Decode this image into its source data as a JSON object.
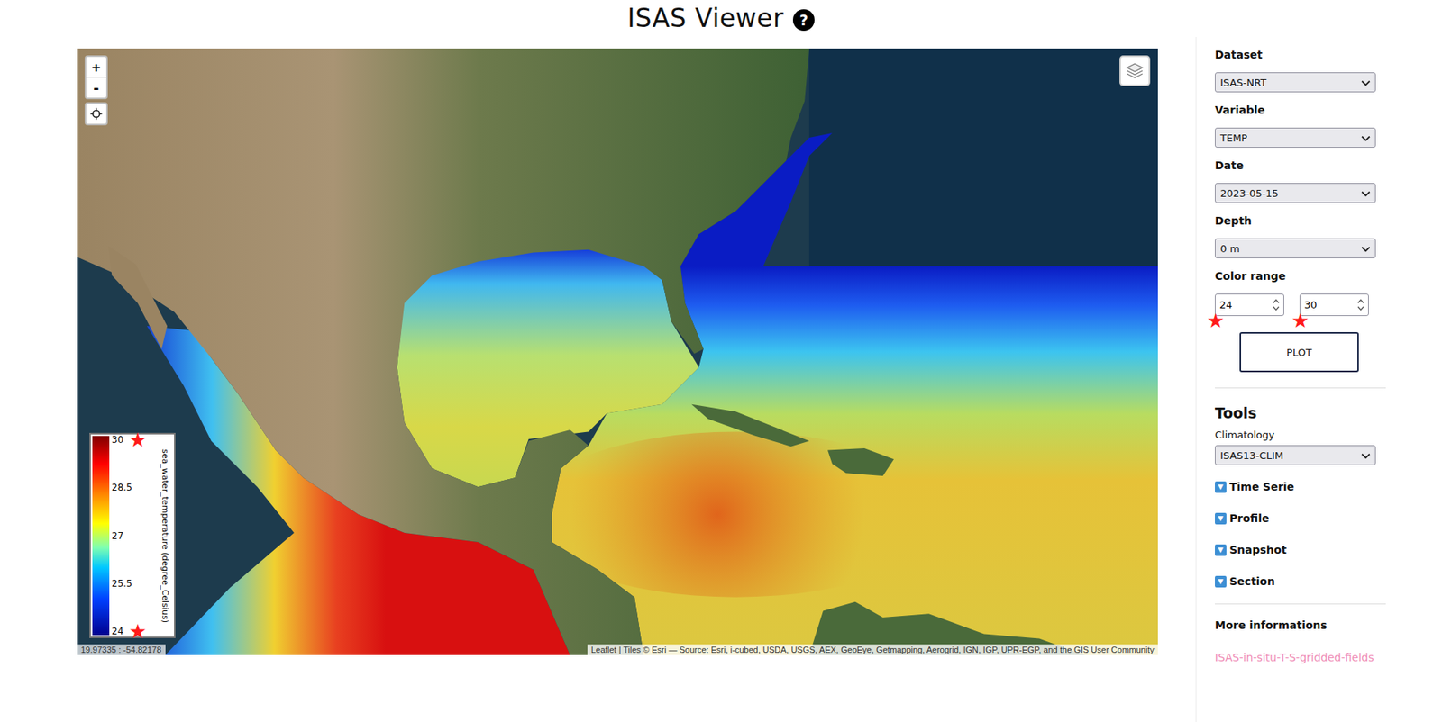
{
  "header": {
    "title": "ISAS Viewer",
    "help_icon": "?"
  },
  "map": {
    "zoom_in": "+",
    "zoom_out": "-",
    "coordinates": "19.97335 : -54.82178",
    "attribution": "Leaflet | Tiles © Esri — Source: Esri, i-cubed, USDA, USGS, AEX, GeoEye, Getmapping, Aerogrid, IGN, IGP, UPR-EGP, and the GIS User Community",
    "legend": {
      "title": "sea_water_temperature (degree_Celsius)",
      "ticks": [
        "30",
        "28.5",
        "27",
        "25.5",
        "24"
      ]
    }
  },
  "sidebar": {
    "fields": [
      {
        "label": "Dataset",
        "value": "ISAS-NRT"
      },
      {
        "label": "Variable",
        "value": "TEMP"
      },
      {
        "label": "Date",
        "value": "2023-05-15"
      },
      {
        "label": "Depth",
        "value": "0 m"
      }
    ],
    "color_range": {
      "label": "Color range",
      "min": "24",
      "max": "30"
    },
    "plot_button": "PLOT",
    "tools": {
      "title": "Tools",
      "climatology_label": "Climatology",
      "climatology": "ISAS13-CLIM",
      "sections": [
        {
          "icon": "▼",
          "label": "Time Serie",
          "expanded": false
        },
        {
          "icon": "▼",
          "label": "Profile",
          "expanded": false
        },
        {
          "icon": "▼",
          "label": "Snapshot",
          "expanded": false
        },
        {
          "icon": "▼",
          "label": "Section",
          "expanded": false
        }
      ]
    },
    "more": {
      "title": "More informations",
      "link": "ISAS-in-situ-T-S-gridded-fields"
    }
  },
  "annotations": {
    "min_input": "★",
    "max_input": "★",
    "legend_top": "★",
    "legend_bottom": "★"
  }
}
